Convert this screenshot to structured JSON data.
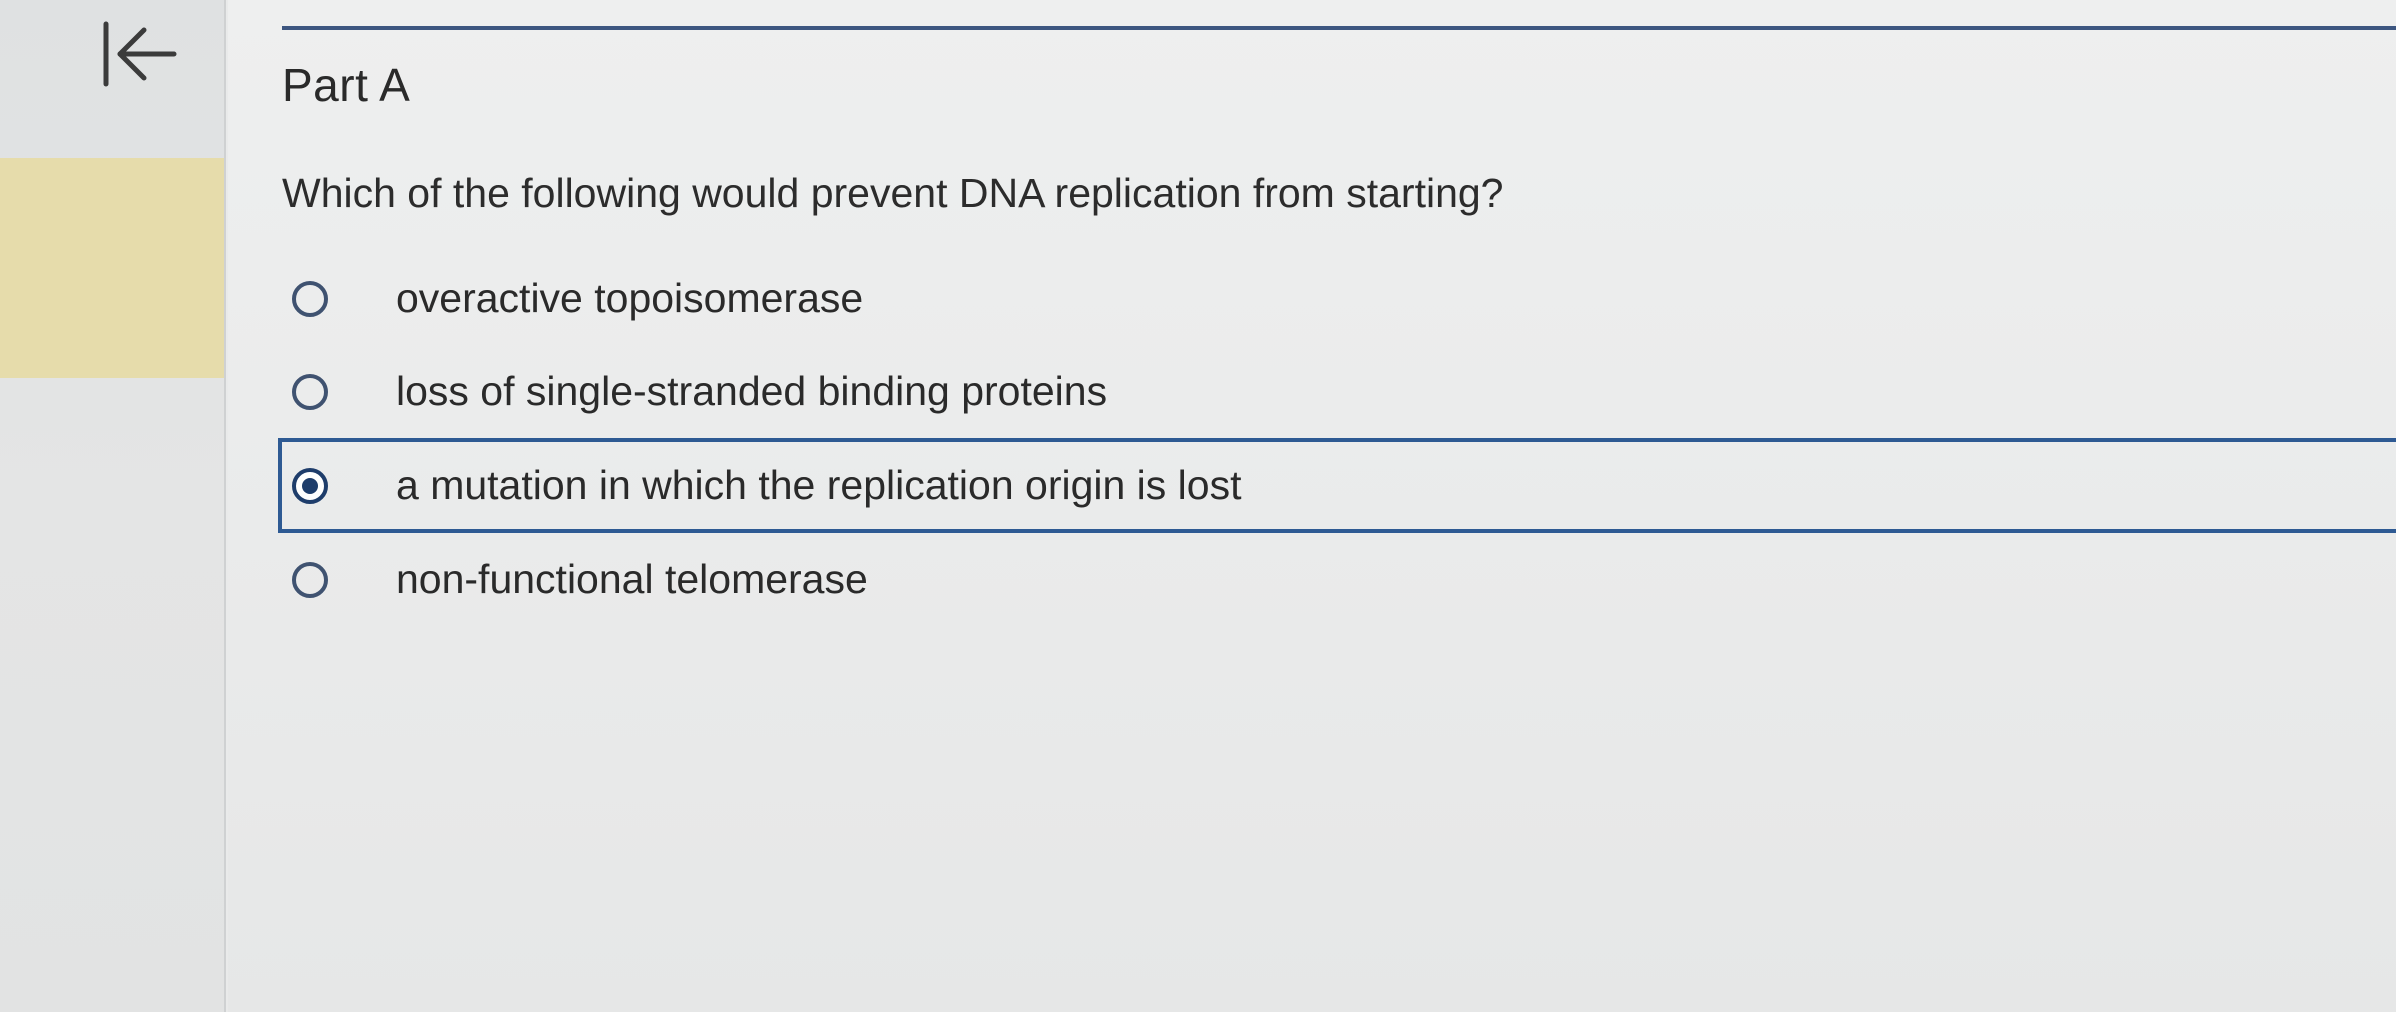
{
  "sidebar": {
    "collapse_icon": "collapse-left-icon"
  },
  "part": {
    "title": "Part A"
  },
  "question": {
    "text": "Which of the following would prevent DNA replication from starting?"
  },
  "options": [
    {
      "label": "overactive topoisomerase",
      "selected": false
    },
    {
      "label": "loss of single-stranded binding proteins",
      "selected": false
    },
    {
      "label": "a mutation in which the replication origin is lost",
      "selected": true
    },
    {
      "label": "non-functional telomerase",
      "selected": false
    }
  ],
  "colors": {
    "accent": "#2e5a93",
    "sidebar_highlight": "#e6dcab"
  }
}
